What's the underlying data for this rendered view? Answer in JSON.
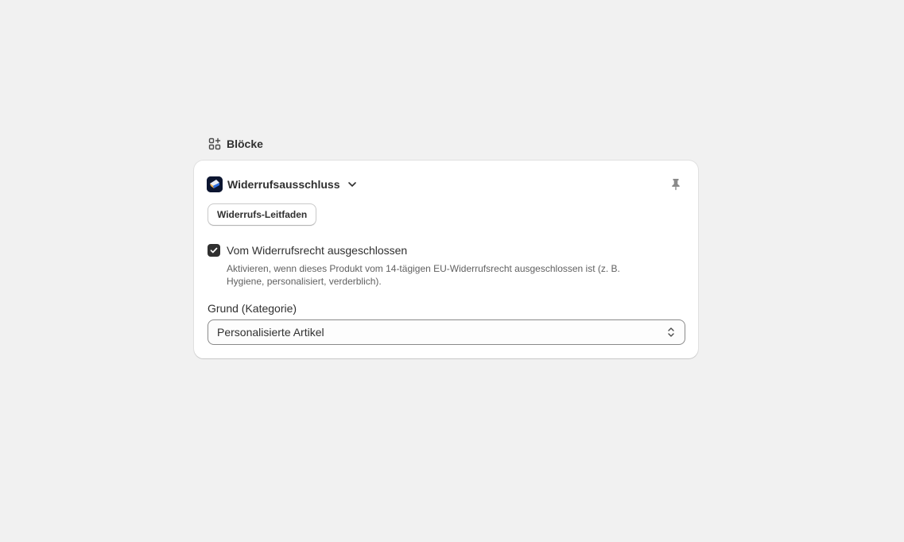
{
  "section": {
    "title": "Blöcke",
    "icon": "blocks-icon"
  },
  "block": {
    "app_title": "Widerrufsausschluss",
    "app_icon": "app-logo-icon",
    "guide_button_label": "Widerrufs-Leitfaden",
    "pin_icon": "pin-icon",
    "checkbox": {
      "label": "Vom Widerrufsrecht ausgeschlossen",
      "checked": true,
      "help": "Aktivieren, wenn dieses Produkt vom 14-tägigen EU-Widerrufsrecht ausgeschlossen ist (z. B. Hygiene, personalisiert, verderblich)."
    },
    "reason_field": {
      "label": "Grund (Kategorie)",
      "selected": "Personalisierte Artikel"
    }
  },
  "colors": {
    "background": "#f1f1f1",
    "card": "#ffffff",
    "text": "#303030",
    "subdued": "#616161",
    "checkbox": "#303030"
  }
}
